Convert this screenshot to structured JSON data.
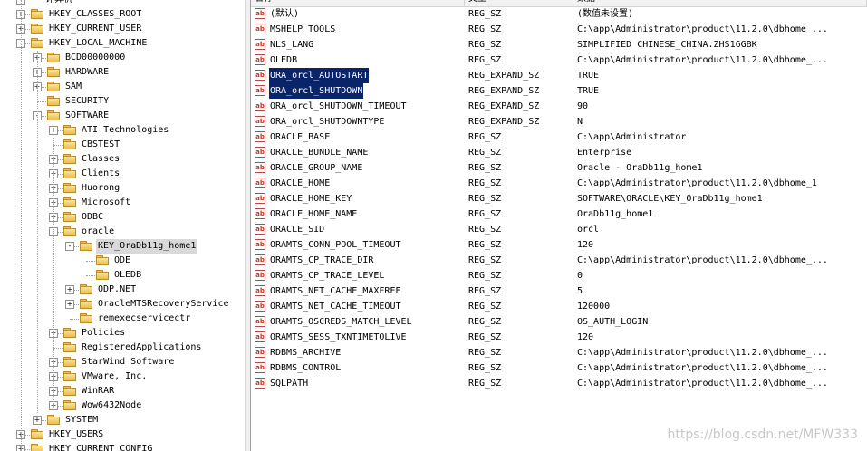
{
  "tree": {
    "root_label": "计算机",
    "nodes": [
      {
        "label": "HKEY_CLASSES_ROOT",
        "depth": 1,
        "expander": "+"
      },
      {
        "label": "HKEY_CURRENT_USER",
        "depth": 1,
        "expander": "+"
      },
      {
        "label": "HKEY_LOCAL_MACHINE",
        "depth": 1,
        "expander": "-"
      },
      {
        "label": "BCD00000000",
        "depth": 2,
        "expander": "+"
      },
      {
        "label": "HARDWARE",
        "depth": 2,
        "expander": "+"
      },
      {
        "label": "SAM",
        "depth": 2,
        "expander": "+"
      },
      {
        "label": "SECURITY",
        "depth": 2,
        "expander": ""
      },
      {
        "label": "SOFTWARE",
        "depth": 2,
        "expander": "-"
      },
      {
        "label": "ATI Technologies",
        "depth": 3,
        "expander": "+"
      },
      {
        "label": "CBSTEST",
        "depth": 3,
        "expander": ""
      },
      {
        "label": "Classes",
        "depth": 3,
        "expander": "+"
      },
      {
        "label": "Clients",
        "depth": 3,
        "expander": "+"
      },
      {
        "label": "Huorong",
        "depth": 3,
        "expander": "+"
      },
      {
        "label": "Microsoft",
        "depth": 3,
        "expander": "+"
      },
      {
        "label": "ODBC",
        "depth": 3,
        "expander": "+"
      },
      {
        "label": "oracle",
        "depth": 3,
        "expander": "-"
      },
      {
        "label": "KEY_OraDb11g_home1",
        "depth": 4,
        "expander": "-",
        "selected": true
      },
      {
        "label": "ODE",
        "depth": 5,
        "expander": ""
      },
      {
        "label": "OLEDB",
        "depth": 5,
        "expander": ""
      },
      {
        "label": "ODP.NET",
        "depth": 4,
        "expander": "+"
      },
      {
        "label": "OracleMTSRecoveryService",
        "depth": 4,
        "expander": "+"
      },
      {
        "label": "remexecservicectr",
        "depth": 4,
        "expander": ""
      },
      {
        "label": "Policies",
        "depth": 3,
        "expander": "+"
      },
      {
        "label": "RegisteredApplications",
        "depth": 3,
        "expander": ""
      },
      {
        "label": "StarWind Software",
        "depth": 3,
        "expander": "+"
      },
      {
        "label": "VMware, Inc.",
        "depth": 3,
        "expander": "+"
      },
      {
        "label": "WinRAR",
        "depth": 3,
        "expander": "+"
      },
      {
        "label": "Wow6432Node",
        "depth": 3,
        "expander": "+"
      },
      {
        "label": "SYSTEM",
        "depth": 2,
        "expander": "+"
      },
      {
        "label": "HKEY_USERS",
        "depth": 1,
        "expander": "+"
      },
      {
        "label": "HKEY_CURRENT_CONFIG",
        "depth": 1,
        "expander": "+"
      }
    ]
  },
  "list": {
    "headers": {
      "name": "名称",
      "type": "类型",
      "data": "数据"
    },
    "value_icon": "ab",
    "rows": [
      {
        "name": "(默认)",
        "type": "REG_SZ",
        "data": "(数值未设置)"
      },
      {
        "name": "MSHELP_TOOLS",
        "type": "REG_SZ",
        "data": "C:\\app\\Administrator\\product\\11.2.0\\dbhome_..."
      },
      {
        "name": "NLS_LANG",
        "type": "REG_SZ",
        "data": "SIMPLIFIED CHINESE_CHINA.ZHS16GBK"
      },
      {
        "name": "OLEDB",
        "type": "REG_SZ",
        "data": "C:\\app\\Administrator\\product\\11.2.0\\dbhome_..."
      },
      {
        "name": "ORA_orcl_AUTOSTART",
        "type": "REG_EXPAND_SZ",
        "data": "TRUE",
        "selected": true
      },
      {
        "name": "ORA_orcl_SHUTDOWN",
        "type": "REG_EXPAND_SZ",
        "data": "TRUE",
        "selected": true
      },
      {
        "name": "ORA_orcl_SHUTDOWN_TIMEOUT",
        "type": "REG_EXPAND_SZ",
        "data": "90"
      },
      {
        "name": "ORA_orcl_SHUTDOWNTYPE",
        "type": "REG_EXPAND_SZ",
        "data": "N"
      },
      {
        "name": "ORACLE_BASE",
        "type": "REG_SZ",
        "data": "C:\\app\\Administrator"
      },
      {
        "name": "ORACLE_BUNDLE_NAME",
        "type": "REG_SZ",
        "data": "Enterprise"
      },
      {
        "name": "ORACLE_GROUP_NAME",
        "type": "REG_SZ",
        "data": "Oracle - OraDb11g_home1"
      },
      {
        "name": "ORACLE_HOME",
        "type": "REG_SZ",
        "data": "C:\\app\\Administrator\\product\\11.2.0\\dbhome_1"
      },
      {
        "name": "ORACLE_HOME_KEY",
        "type": "REG_SZ",
        "data": "SOFTWARE\\ORACLE\\KEY_OraDb11g_home1"
      },
      {
        "name": "ORACLE_HOME_NAME",
        "type": "REG_SZ",
        "data": "OraDb11g_home1"
      },
      {
        "name": "ORACLE_SID",
        "type": "REG_SZ",
        "data": "orcl"
      },
      {
        "name": "ORAMTS_CONN_POOL_TIMEOUT",
        "type": "REG_SZ",
        "data": "120"
      },
      {
        "name": "ORAMTS_CP_TRACE_DIR",
        "type": "REG_SZ",
        "data": "C:\\app\\Administrator\\product\\11.2.0\\dbhome_..."
      },
      {
        "name": "ORAMTS_CP_TRACE_LEVEL",
        "type": "REG_SZ",
        "data": "0"
      },
      {
        "name": "ORAMTS_NET_CACHE_MAXFREE",
        "type": "REG_SZ",
        "data": "5"
      },
      {
        "name": "ORAMTS_NET_CACHE_TIMEOUT",
        "type": "REG_SZ",
        "data": "120000"
      },
      {
        "name": "ORAMTS_OSCREDS_MATCH_LEVEL",
        "type": "REG_SZ",
        "data": "OS_AUTH_LOGIN"
      },
      {
        "name": "ORAMTS_SESS_TXNTIMETOLIVE",
        "type": "REG_SZ",
        "data": "120"
      },
      {
        "name": "RDBMS_ARCHIVE",
        "type": "REG_SZ",
        "data": "C:\\app\\Administrator\\product\\11.2.0\\dbhome_..."
      },
      {
        "name": "RDBMS_CONTROL",
        "type": "REG_SZ",
        "data": "C:\\app\\Administrator\\product\\11.2.0\\dbhome_..."
      },
      {
        "name": "SQLPATH",
        "type": "REG_SZ",
        "data": "C:\\app\\Administrator\\product\\11.2.0\\dbhome_..."
      }
    ]
  },
  "watermark": "https://blog.csdn.net/MFW333",
  "colors": {
    "selection": "#0a246a",
    "tree_selection": "#d9d9d9",
    "folder": "#e8bd4f"
  }
}
